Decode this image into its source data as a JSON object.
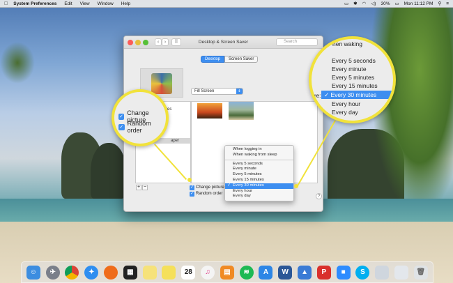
{
  "menubar": {
    "apple": "",
    "items": [
      "System Preferences",
      "Edit",
      "View",
      "Window",
      "Help"
    ],
    "battery": "30%",
    "clock": "Mon 11:12 PM"
  },
  "window": {
    "title": "Desktop & Screen Saver",
    "search_placeholder": "Search",
    "tabs": [
      "Desktop",
      "Screen Saver"
    ],
    "fill_mode": "Fill Screen",
    "sidebar_partial_label": "ctures",
    "sidebar_selected_partial": "aper",
    "change_picture_label": "Change picture",
    "random_order_label": "Random order",
    "help_label": "?",
    "add_label": "+",
    "remove_label": "−"
  },
  "interval_menu": {
    "items": [
      "When logging in",
      "When waking from sleep",
      "Every 5 seconds",
      "Every minute",
      "Every 5 minutes",
      "Every 15 minutes",
      "Every 30 minutes",
      "Every hour",
      "Every day"
    ],
    "selected": "Every 30 minutes",
    "check": "✓"
  },
  "magnifier_right": {
    "top_partial": "hen waking",
    "label_partial": "re:",
    "items": [
      "Every 5 seconds",
      "Every minute",
      "Every 5 minutes",
      "Every 15 minutes",
      "Every 30 minutes",
      "Every hour",
      "Every day"
    ]
  },
  "magnifier_left": {
    "change_picture": "Change picture",
    "random_order": "Random order"
  },
  "dock": {
    "apps": [
      "Finder",
      "Launchpad",
      "Chrome",
      "Safari",
      "Firefox",
      "Photo Booth",
      "Notes",
      "Stickies",
      "Calendar",
      "iTunes",
      "iBooks",
      "Spotify",
      "App Store",
      "Word",
      "Keynote",
      "WPS",
      "Zoom",
      "Skype",
      "Preview",
      "Finder Window",
      "Trash"
    ],
    "calendar_day": "28",
    "word_letter": "W",
    "wps_letter": "P"
  }
}
